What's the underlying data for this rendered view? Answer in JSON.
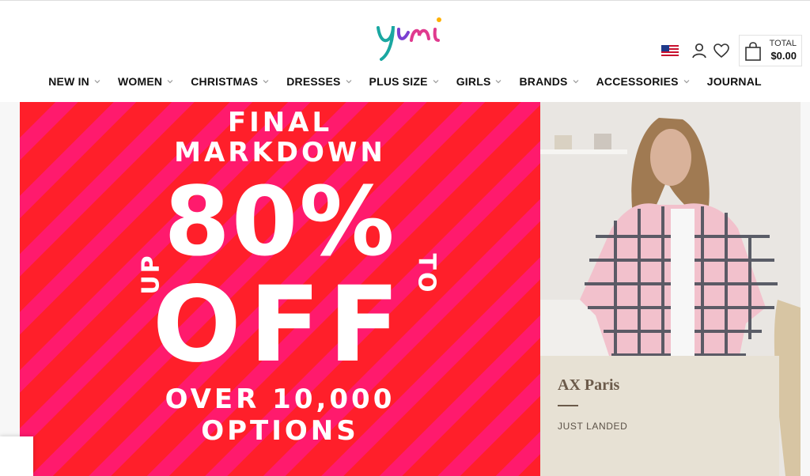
{
  "brand": {
    "logo_text": "Yumi",
    "logo_colors": [
      "#1aa7a1",
      "#e03a8e",
      "#6b3fd1",
      "#ffb000"
    ]
  },
  "header": {
    "flag": "us-flag",
    "icons": [
      "account-icon",
      "wishlist-heart-icon",
      "shopping-bag-icon"
    ],
    "cart": {
      "label": "TOTAL",
      "amount": "$0.00"
    }
  },
  "nav": {
    "items": [
      {
        "label": "NEW IN",
        "has_dropdown": true
      },
      {
        "label": "WOMEN",
        "has_dropdown": true
      },
      {
        "label": "CHRISTMAS",
        "has_dropdown": true
      },
      {
        "label": "DRESSES",
        "has_dropdown": true
      },
      {
        "label": "PLUS SIZE",
        "has_dropdown": true
      },
      {
        "label": "GIRLS",
        "has_dropdown": true
      },
      {
        "label": "BRANDS",
        "has_dropdown": true
      },
      {
        "label": "ACCESSORIES",
        "has_dropdown": true
      },
      {
        "label": "JOURNAL",
        "has_dropdown": false
      }
    ]
  },
  "hero": {
    "line1": "FINAL",
    "line2": "MARKDOWN",
    "up": "UP",
    "percent": "80%",
    "to": "TO",
    "off": "OFF",
    "over": "OVER 10,000",
    "options": "OPTIONS",
    "colors": {
      "stripe_a": "#ff1f2a",
      "stripe_b": "#ff1a6d",
      "text": "#ffffff"
    }
  },
  "promo": {
    "brand": "AX Paris",
    "subtitle": "JUST LANDED",
    "image": "model-in-pink-checked-shacket"
  }
}
